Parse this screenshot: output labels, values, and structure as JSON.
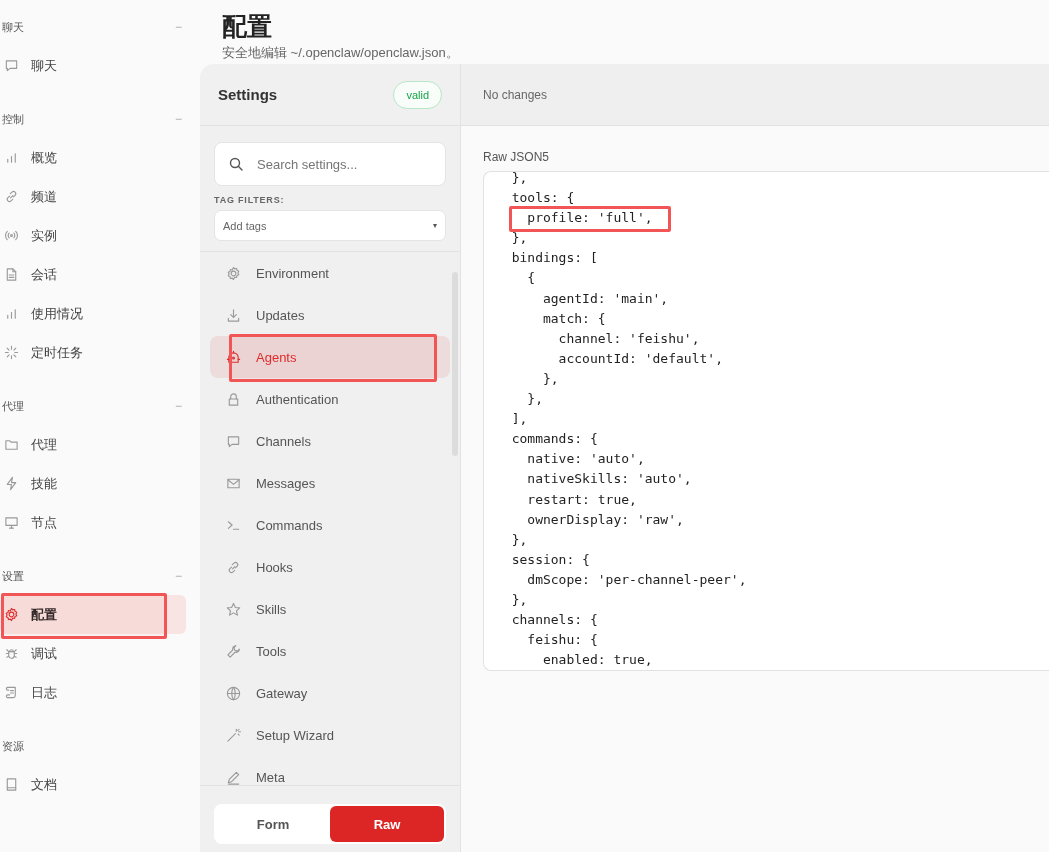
{
  "nav": [
    {
      "title": "聊天",
      "toggle": "−",
      "items": [
        {
          "label": "聊天",
          "selected": false,
          "annotated": false
        }
      ]
    },
    {
      "title": "控制",
      "toggle": "−",
      "items": [
        {
          "label": "概览",
          "selected": false,
          "annotated": false
        },
        {
          "label": "频道",
          "selected": false,
          "annotated": false
        },
        {
          "label": "实例",
          "selected": false,
          "annotated": false
        },
        {
          "label": "会话",
          "selected": false,
          "annotated": false
        },
        {
          "label": "使用情况",
          "selected": false,
          "annotated": false
        },
        {
          "label": "定时任务",
          "selected": false,
          "annotated": false
        }
      ]
    },
    {
      "title": "代理",
      "toggle": "−",
      "items": [
        {
          "label": "代理",
          "selected": false,
          "annotated": false
        },
        {
          "label": "技能",
          "selected": false,
          "annotated": false
        },
        {
          "label": "节点",
          "selected": false,
          "annotated": false
        }
      ]
    },
    {
      "title": "设置",
      "toggle": "−",
      "items": [
        {
          "label": "配置",
          "selected": true,
          "annotated": true
        },
        {
          "label": "调试",
          "selected": false,
          "annotated": false
        },
        {
          "label": "日志",
          "selected": false,
          "annotated": false
        }
      ]
    },
    {
      "title": "资源",
      "items": [
        {
          "label": "文档",
          "selected": false,
          "annotated": false
        }
      ]
    }
  ],
  "page": {
    "title": "配置",
    "subtitle": "安全地编辑 ~/.openclaw/openclaw.json。"
  },
  "settings": {
    "title": "Settings",
    "status": "valid",
    "search": {
      "placeholder": "Search settings..."
    },
    "tag_filters_label": "TAG FILTERS:",
    "tags": {
      "placeholder": "Add tags",
      "caret": "▾"
    },
    "sections": [
      {
        "label": "Environment",
        "selected": false,
        "annotated": false
      },
      {
        "label": "Updates",
        "selected": false,
        "annotated": false
      },
      {
        "label": "Agents",
        "selected": true,
        "annotated": true
      },
      {
        "label": "Authentication",
        "selected": false,
        "annotated": false
      },
      {
        "label": "Channels",
        "selected": false,
        "annotated": false
      },
      {
        "label": "Messages",
        "selected": false,
        "annotated": false
      },
      {
        "label": "Commands",
        "selected": false,
        "annotated": false
      },
      {
        "label": "Hooks",
        "selected": false,
        "annotated": false
      },
      {
        "label": "Skills",
        "selected": false,
        "annotated": false
      },
      {
        "label": "Tools",
        "selected": false,
        "annotated": false
      },
      {
        "label": "Gateway",
        "selected": false,
        "annotated": false
      },
      {
        "label": "Setup Wizard",
        "selected": false,
        "annotated": false
      },
      {
        "label": "Meta",
        "selected": false,
        "annotated": false
      }
    ],
    "modes": [
      {
        "label": "Form",
        "selected": false
      },
      {
        "label": "Raw",
        "selected": true
      }
    ]
  },
  "editor": {
    "status": "No changes",
    "label": "Raw JSON5",
    "lines": [
      {
        "text": "  },",
        "annotated": false
      },
      {
        "text": "  tools: {",
        "annotated": false
      },
      {
        "text": "    profile: 'full',",
        "annotated": true
      },
      {
        "text": "  },",
        "annotated": false
      },
      {
        "text": "  bindings: [",
        "annotated": false
      },
      {
        "text": "    {",
        "annotated": false
      },
      {
        "text": "      agentId: 'main',",
        "annotated": false
      },
      {
        "text": "      match: {",
        "annotated": false
      },
      {
        "text": "        channel: 'feishu',",
        "annotated": false
      },
      {
        "text": "        accountId: 'default',",
        "annotated": false
      },
      {
        "text": "      },",
        "annotated": false
      },
      {
        "text": "    },",
        "annotated": false
      },
      {
        "text": "  ],",
        "annotated": false
      },
      {
        "text": "  commands: {",
        "annotated": false
      },
      {
        "text": "    native: 'auto',",
        "annotated": false
      },
      {
        "text": "    nativeSkills: 'auto',",
        "annotated": false
      },
      {
        "text": "    restart: true,",
        "annotated": false
      },
      {
        "text": "    ownerDisplay: 'raw',",
        "annotated": false
      },
      {
        "text": "  },",
        "annotated": false
      },
      {
        "text": "  session: {",
        "annotated": false
      },
      {
        "text": "    dmScope: 'per-channel-peer',",
        "annotated": false
      },
      {
        "text": "  },",
        "annotated": false
      },
      {
        "text": "  channels: {",
        "annotated": false
      },
      {
        "text": "    feishu: {",
        "annotated": false
      },
      {
        "text": "      enabled: true,",
        "annotated": false
      }
    ]
  }
}
